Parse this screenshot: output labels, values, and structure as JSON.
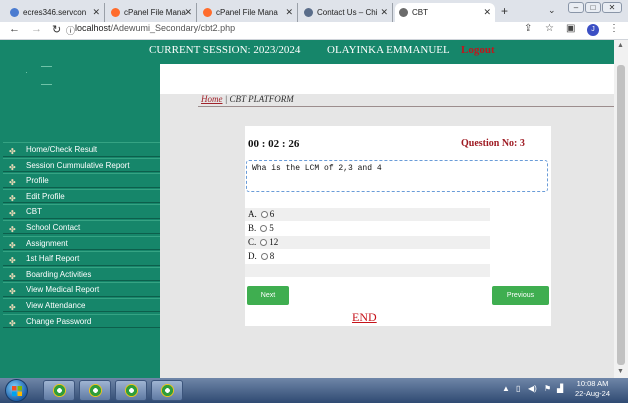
{
  "browser": {
    "tabs": [
      {
        "title": "ecres346.servcon",
        "icon": "globe-icon"
      },
      {
        "title": "cPanel File Mana",
        "icon": "cpanel-icon"
      },
      {
        "title": "cPanel File Mana",
        "icon": "cpanel-icon"
      },
      {
        "title": "Contact Us – Chi",
        "icon": "globe-icon"
      },
      {
        "title": "CBT",
        "icon": "globe-icon"
      }
    ],
    "new_tab": "+",
    "url_host": "localhost",
    "url_path": "/Adewumi_Secondary/cbt2.php",
    "profile_initial": "J"
  },
  "header": {
    "session": "CURRENT SESSION: 2023/2024",
    "user": "OLAYINKA EMMANUEL",
    "logout": "Logout"
  },
  "sidebar": {
    "items": [
      {
        "label": "Home/Check Result"
      },
      {
        "label": "Session Cummulative Report"
      },
      {
        "label": "Profile"
      },
      {
        "label": "Edit Profile"
      },
      {
        "label": "CBT"
      },
      {
        "label": "School Contact"
      },
      {
        "label": "Assignment"
      },
      {
        "label": "1st Half Report"
      },
      {
        "label": "Boarding Activities"
      },
      {
        "label": "View Medical Report"
      },
      {
        "label": "View Attendance"
      },
      {
        "label": "Change Password"
      }
    ]
  },
  "breadcrumb": {
    "home": "Home",
    "separator": " | ",
    "current": "CBT PLATFORM"
  },
  "exam": {
    "timer": "00 : 02 : 26",
    "question_no": "Question No: 3",
    "question": "Wha is the LCM of 2,3 and 4",
    "options": [
      {
        "letter": "A.",
        "value": "6"
      },
      {
        "letter": "B.",
        "value": "5"
      },
      {
        "letter": "C.",
        "value": "12"
      },
      {
        "letter": "D.",
        "value": "8"
      }
    ],
    "next_label": "Next",
    "previous_label": "Previous",
    "end_label": "END"
  },
  "taskbar": {
    "time": "10:08 AM",
    "date": "22-Aug-24"
  },
  "colors": {
    "brand_green": "#16866a",
    "button_green": "#3fae50",
    "logout_red": "#c0161c",
    "question_red": "#9e1a22"
  }
}
